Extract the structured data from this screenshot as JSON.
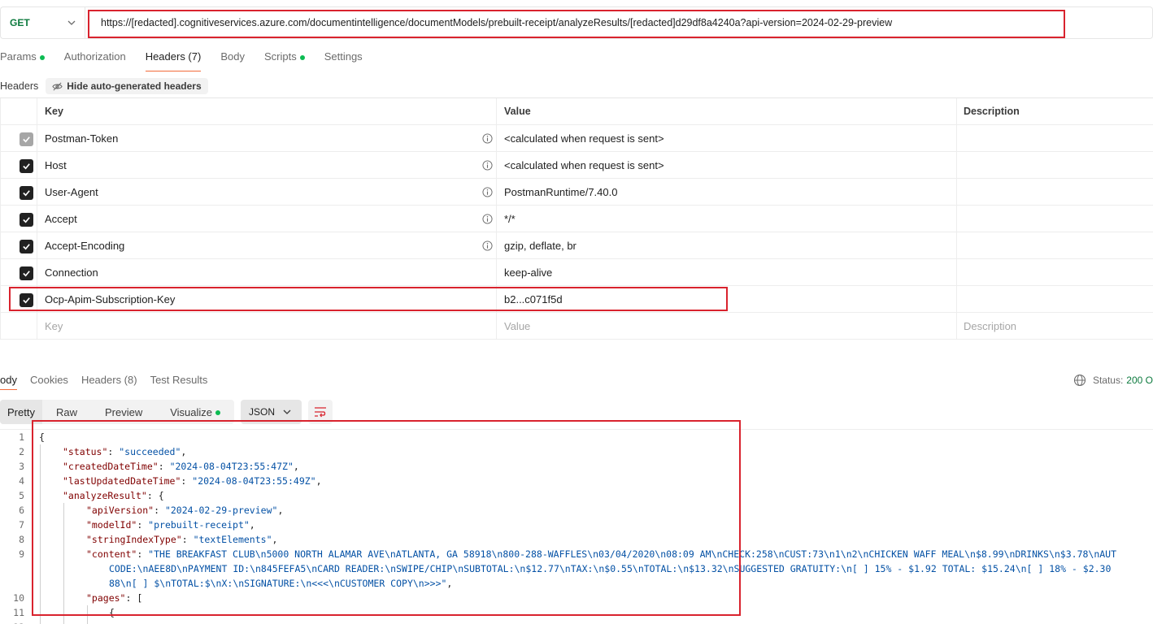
{
  "request": {
    "method": "GET",
    "url": "https://.../documentintelligence/documentModels/prebuilt-receipt/analyzeResults/...a29df8a4240a?api-version=2024-02-29-preview",
    "url_display": "https://[redacted].cognitiveservices.azure.com/documentintelligence/documentModels/prebuilt-receipt/analyzeResults/[redacted]d29df8a4240a?api-version=2024-02-29-preview"
  },
  "request_tabs": [
    {
      "label": "Params",
      "dot": true
    },
    {
      "label": "Authorization",
      "dot": false
    },
    {
      "label": "Headers (7)",
      "dot": false,
      "active": true
    },
    {
      "label": "Body",
      "dot": false
    },
    {
      "label": "Scripts",
      "dot": true
    },
    {
      "label": "Settings",
      "dot": false
    }
  ],
  "headers_section": {
    "label": "Headers",
    "hide_button": "Hide auto-generated headers"
  },
  "table": {
    "columns": [
      "Key",
      "Value",
      "Description"
    ],
    "rows": [
      {
        "key": "Postman-Token",
        "value": "<calculated when request is sent>",
        "checked": "grey"
      },
      {
        "key": "Host",
        "value": "<calculated when request is sent>",
        "checked": "yes"
      },
      {
        "key": "User-Agent",
        "value": "PostmanRuntime/7.40.0",
        "checked": "yes"
      },
      {
        "key": "Accept",
        "value": "*/*",
        "checked": "yes"
      },
      {
        "key": "Accept-Encoding",
        "value": "gzip, deflate, br",
        "checked": "yes"
      },
      {
        "key": "Connection",
        "value": "keep-alive",
        "checked": "yes"
      },
      {
        "key": "Ocp-Apim-Subscription-Key",
        "value": "b2...c071f5d",
        "checked": "yes"
      }
    ],
    "placeholder": {
      "key": "Key",
      "value": "Value",
      "description": "Description"
    }
  },
  "response_tabs": [
    {
      "label": "ody",
      "active": true
    },
    {
      "label": "Cookies"
    },
    {
      "label": "Headers (8)"
    },
    {
      "label": "Test Results"
    }
  ],
  "status": {
    "label": "Status:",
    "value": "200 O"
  },
  "view_modes": [
    "Pretty",
    "Raw",
    "Preview",
    "Visualize"
  ],
  "format": "JSON",
  "code_lines": {
    "l1": "{",
    "l2k": "\"status\"",
    "l2v": "\"succeeded\"",
    "l3k": "\"createdDateTime\"",
    "l3v": "\"2024-08-04T23:55:47Z\"",
    "l4k": "\"lastUpdatedDateTime\"",
    "l4v": "\"2024-08-04T23:55:49Z\"",
    "l5k": "\"analyzeResult\"",
    "l6k": "\"apiVersion\"",
    "l6v": "\"2024-02-29-preview\"",
    "l7k": "\"modelId\"",
    "l7v": "\"prebuilt-receipt\"",
    "l8k": "\"stringIndexType\"",
    "l8v": "\"textElements\"",
    "l9k": "\"content\"",
    "l9v_a": "\"THE BREAKFAST CLUB\\n5000 NORTH ALAMAR AVE\\nATLANTA, GA 58918\\n800-288-WAFFLES\\n03/04/2020\\n08:09 AM\\nCHECK:258\\nCUST:73\\n1\\n2\\nCHICKEN WAFF MEAL\\n$8.99\\nDRINKS\\n$3.78\\nAUT",
    "l9v_b": "CODE:\\nAEE8D\\nPAYMENT ID:\\n845FEFA5\\nCARD READER:\\nSWIPE/CHIP\\nSUBTOTAL:\\n$12.77\\nTAX:\\n$0.55\\nTOTAL:\\n$13.32\\nSUGGESTED GRATUITY:\\n[ ] 15% - $1.92 TOTAL: $15.24\\n[ ] 18% - $2.30",
    "l9v_c": "88\\n[ ] $\\nTOTAL:$\\nX:\\nSIGNATURE:\\n<<<\\nCUSTOMER COPY\\n>>>\"",
    "l10k": "\"pages\"",
    "l11": "{"
  },
  "line_numbers": [
    "1",
    "2",
    "3",
    "4",
    "5",
    "6",
    "7",
    "8",
    "9",
    "10",
    "11",
    "12"
  ]
}
